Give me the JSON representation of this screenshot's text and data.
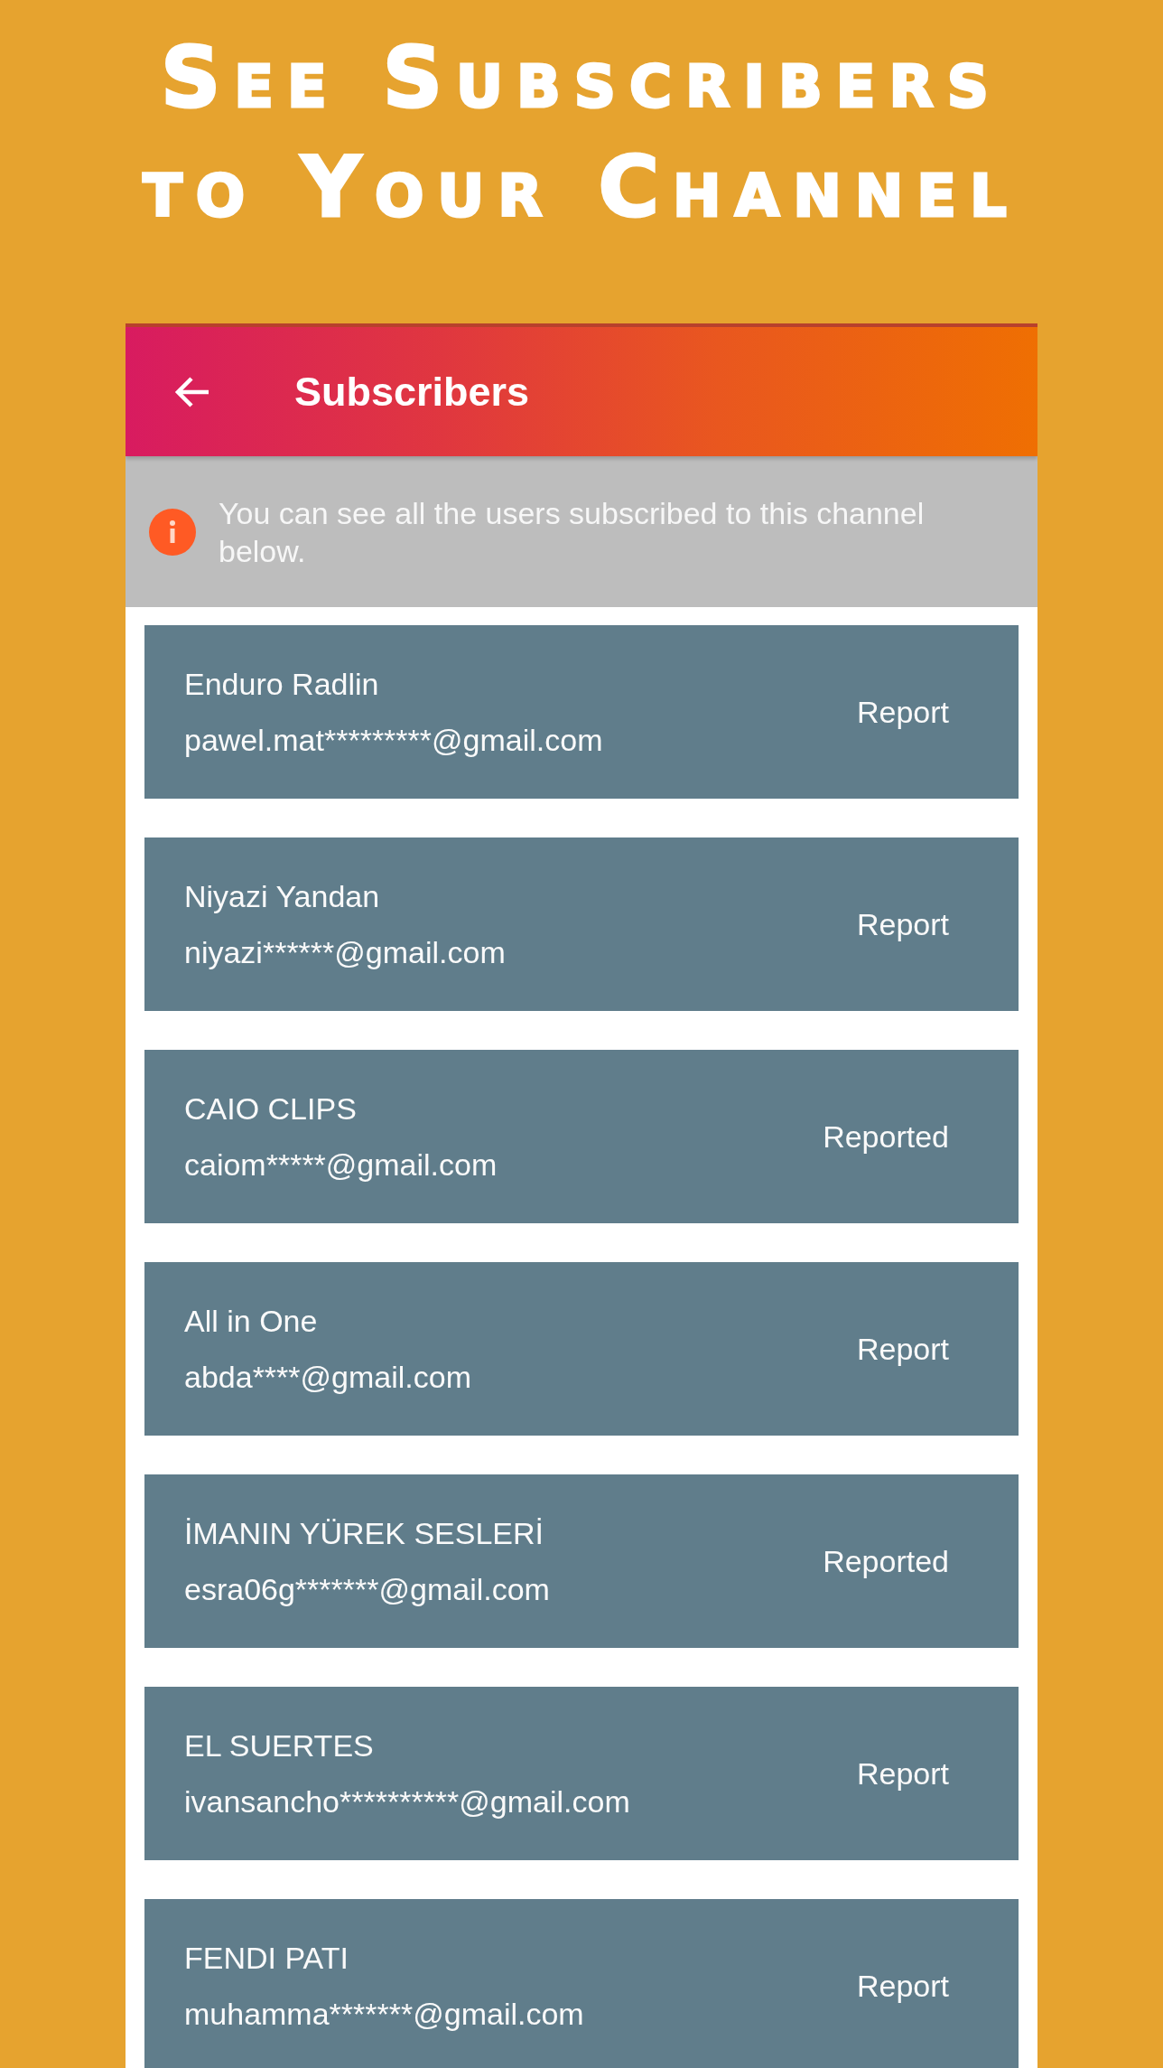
{
  "headline": {
    "lines": [
      "See Subscribers",
      "to Your Channel"
    ]
  },
  "app_bar": {
    "title": "Subscribers"
  },
  "notice": {
    "text": "You can see all the users subscribed to this channel below."
  },
  "subscribers": [
    {
      "name": "Enduro Radlin",
      "email": "pawel.mat*********@gmail.com",
      "action": "Report"
    },
    {
      "name": "Niyazi Yandan",
      "email": "niyazi******@gmail.com",
      "action": "Report"
    },
    {
      "name": "CAIO CLIPS",
      "email": "caiom*****@gmail.com",
      "action": "Reported"
    },
    {
      "name": "All in One",
      "email": "abda****@gmail.com",
      "action": "Report"
    },
    {
      "name": "İMANIN YÜREK SESLERİ",
      "email": "esra06g*******@gmail.com",
      "action": "Reported"
    },
    {
      "name": "EL SUERTES",
      "email": "ivansancho**********@gmail.com",
      "action": "Report"
    },
    {
      "name": "FENDI PATI",
      "email": "muhamma*******@gmail.com",
      "action": "Report"
    }
  ]
}
